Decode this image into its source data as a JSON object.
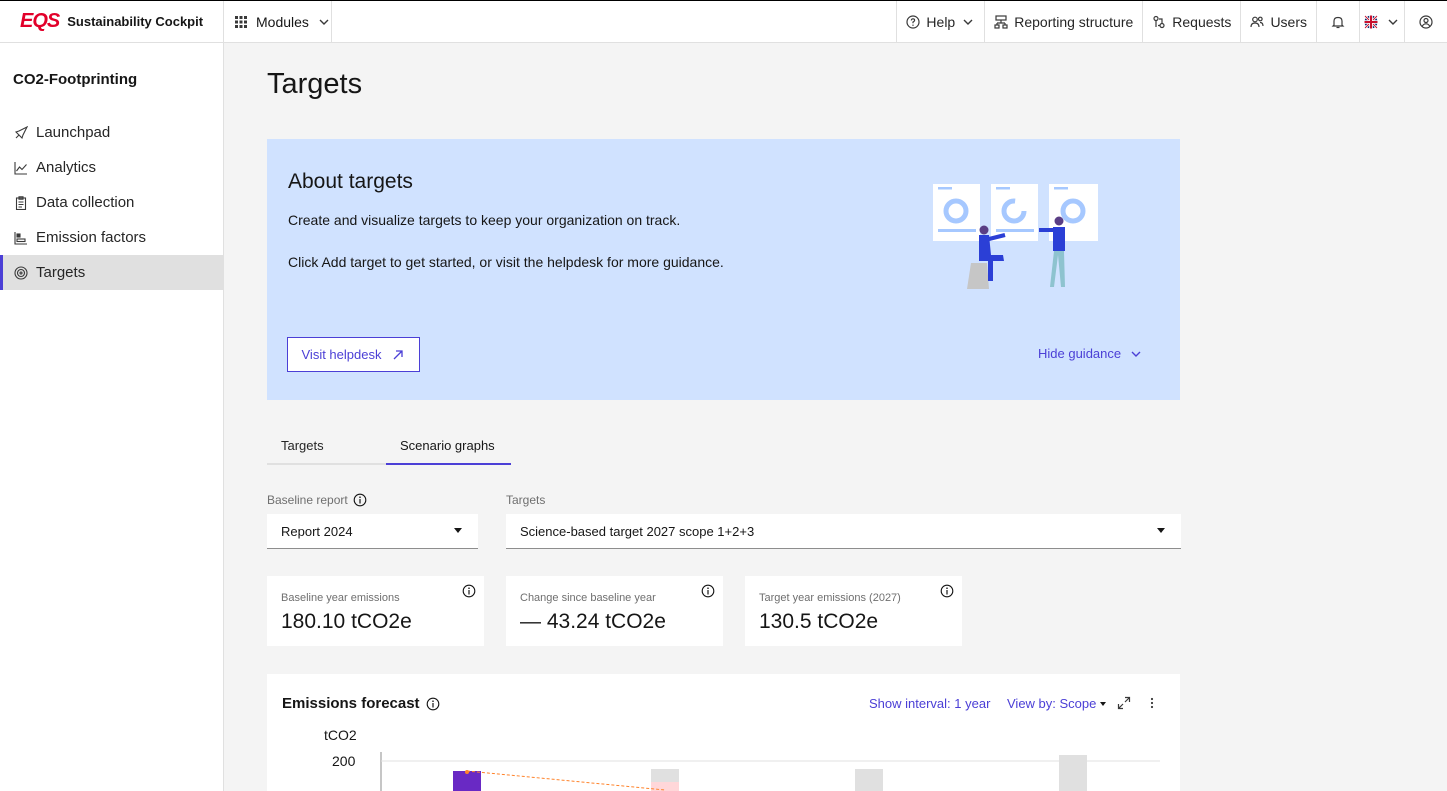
{
  "app": {
    "logo": "EQS",
    "name": "Sustainability Cockpit"
  },
  "topnav": {
    "modules": "Modules",
    "help": "Help",
    "reporting_structure": "Reporting structure",
    "requests": "Requests",
    "users": "Users"
  },
  "sidebar": {
    "title": "CO2-Footprinting",
    "items": [
      {
        "label": "Launchpad",
        "icon": "rocket-icon"
      },
      {
        "label": "Analytics",
        "icon": "chart-icon"
      },
      {
        "label": "Data collection",
        "icon": "clipboard-icon"
      },
      {
        "label": "Emission factors",
        "icon": "factor-icon"
      },
      {
        "label": "Targets",
        "icon": "target-icon",
        "active": true
      }
    ]
  },
  "page": {
    "title": "Targets"
  },
  "about": {
    "title": "About targets",
    "p1": "Create and visualize targets to keep your organization on track.",
    "p2": "Click Add target to get started, or visit the helpdesk for more guidance.",
    "helpdesk_button": "Visit helpdesk",
    "hide_guidance": "Hide guidance"
  },
  "tabs": [
    {
      "label": "Targets"
    },
    {
      "label": "Scenario graphs",
      "active": true
    }
  ],
  "filters": {
    "baseline_label": "Baseline report",
    "baseline_value": "Report 2024",
    "targets_label": "Targets",
    "targets_value": "Science-based target 2027 scope 1+2+3"
  },
  "kpis": [
    {
      "label": "Baseline year emissions",
      "value": "180.10 tCO2e"
    },
    {
      "label": "Change since baseline year",
      "value": "— 43.24 tCO2e"
    },
    {
      "label": "Target year emissions (2027)",
      "value": "130.5 tCO2e"
    }
  ],
  "chart": {
    "title": "Emissions forecast",
    "interval": "Show interval: 1 year",
    "view_by": "View by: Scope",
    "y_unit": "tCO2",
    "y_tick": "200"
  },
  "colors": {
    "accent": "#4b3fd6",
    "brand": "#e2002a",
    "guidance_bg": "#d0e2ff",
    "bar_primary": "#6929c4"
  }
}
